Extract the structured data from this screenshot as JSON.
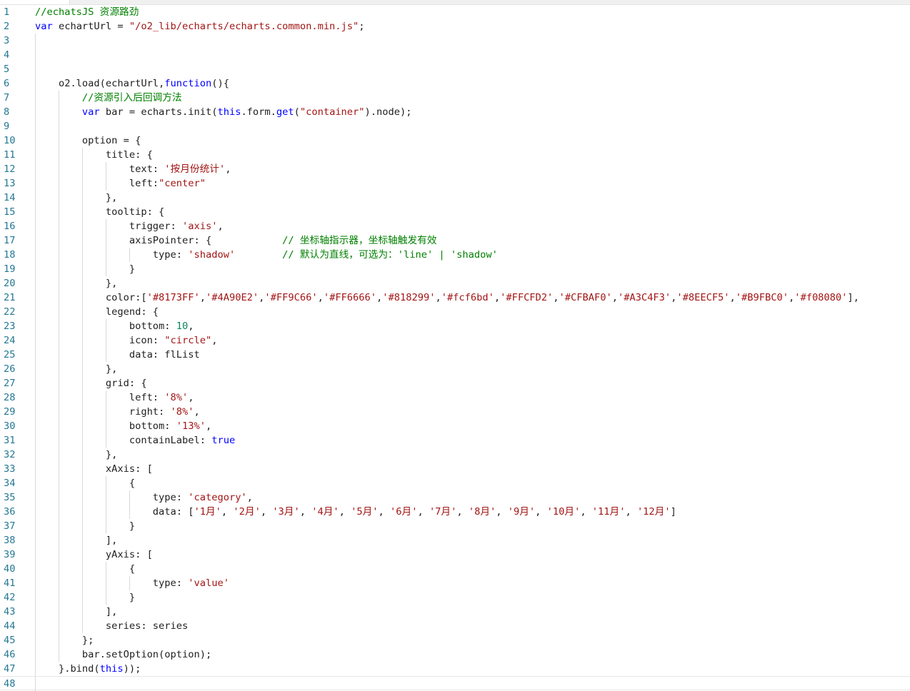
{
  "lines": [
    [
      [
        "c",
        "//echatsJS 资源路劲"
      ]
    ],
    [
      [
        "k",
        "var"
      ],
      [
        "p",
        " echartUrl = "
      ],
      [
        "s",
        "\"/o2_lib/echarts/echarts.common.min.js\""
      ],
      [
        "p",
        ";"
      ]
    ],
    [],
    [],
    [],
    [
      [
        "p",
        "    o2.load(echartUrl,"
      ],
      [
        "k",
        "function"
      ],
      [
        "p",
        "(){"
      ]
    ],
    [
      [
        "c",
        "        //资源引入后回调方法"
      ]
    ],
    [
      [
        "k",
        "        var"
      ],
      [
        "p",
        " bar = echarts.init("
      ],
      [
        "k",
        "this"
      ],
      [
        "p",
        ".form."
      ],
      [
        "k",
        "get"
      ],
      [
        "p",
        "("
      ],
      [
        "s",
        "\"container\""
      ],
      [
        "p",
        ").node);"
      ]
    ],
    [],
    [
      [
        "p",
        "        option = {"
      ]
    ],
    [
      [
        "p",
        "            title: {"
      ]
    ],
    [
      [
        "p",
        "                text: "
      ],
      [
        "s",
        "'按月份统计'"
      ],
      [
        "p",
        ","
      ]
    ],
    [
      [
        "p",
        "                left:"
      ],
      [
        "s",
        "\"center\""
      ]
    ],
    [
      [
        "p",
        "            },"
      ]
    ],
    [
      [
        "p",
        "            tooltip: {"
      ]
    ],
    [
      [
        "p",
        "                trigger: "
      ],
      [
        "s",
        "'axis'"
      ],
      [
        "p",
        ","
      ]
    ],
    [
      [
        "p",
        "                axisPointer: {            "
      ],
      [
        "c",
        "// 坐标轴指示器，坐标轴触发有效"
      ]
    ],
    [
      [
        "p",
        "                    type: "
      ],
      [
        "s",
        "'shadow'"
      ],
      [
        "p",
        "        "
      ],
      [
        "c",
        "// 默认为直线，可选为：'line' | 'shadow'"
      ]
    ],
    [
      [
        "p",
        "                }"
      ]
    ],
    [
      [
        "p",
        "            },"
      ]
    ],
    [
      [
        "p",
        "            color:["
      ],
      [
        "s",
        "'#8173FF'"
      ],
      [
        "p",
        ","
      ],
      [
        "s",
        "'#4A90E2'"
      ],
      [
        "p",
        ","
      ],
      [
        "s",
        "'#FF9C66'"
      ],
      [
        "p",
        ","
      ],
      [
        "s",
        "'#FF6666'"
      ],
      [
        "p",
        ","
      ],
      [
        "s",
        "'#818299'"
      ],
      [
        "p",
        ","
      ],
      [
        "s",
        "'#fcf6bd'"
      ],
      [
        "p",
        ","
      ],
      [
        "s",
        "'#FFCFD2'"
      ],
      [
        "p",
        ","
      ],
      [
        "s",
        "'#CFBAF0'"
      ],
      [
        "p",
        ","
      ],
      [
        "s",
        "'#A3C4F3'"
      ],
      [
        "p",
        ","
      ],
      [
        "s",
        "'#8EECF5'"
      ],
      [
        "p",
        ","
      ],
      [
        "s",
        "'#B9FBC0'"
      ],
      [
        "p",
        ","
      ],
      [
        "s",
        "'#f08080'"
      ],
      [
        "p",
        "],"
      ]
    ],
    [
      [
        "p",
        "            legend: {"
      ]
    ],
    [
      [
        "p",
        "                bottom: "
      ],
      [
        "n",
        "10"
      ],
      [
        "p",
        ","
      ]
    ],
    [
      [
        "p",
        "                icon: "
      ],
      [
        "s",
        "\"circle\""
      ],
      [
        "p",
        ","
      ]
    ],
    [
      [
        "p",
        "                data: flList"
      ]
    ],
    [
      [
        "p",
        "            },"
      ]
    ],
    [
      [
        "p",
        "            grid: {"
      ]
    ],
    [
      [
        "p",
        "                left: "
      ],
      [
        "s",
        "'8%'"
      ],
      [
        "p",
        ","
      ]
    ],
    [
      [
        "p",
        "                right: "
      ],
      [
        "s",
        "'8%'"
      ],
      [
        "p",
        ","
      ]
    ],
    [
      [
        "p",
        "                bottom: "
      ],
      [
        "s",
        "'13%'"
      ],
      [
        "p",
        ","
      ]
    ],
    [
      [
        "p",
        "                containLabel: "
      ],
      [
        "k",
        "true"
      ]
    ],
    [
      [
        "p",
        "            },"
      ]
    ],
    [
      [
        "p",
        "            xAxis: ["
      ]
    ],
    [
      [
        "p",
        "                {"
      ]
    ],
    [
      [
        "p",
        "                    type: "
      ],
      [
        "s",
        "'category'"
      ],
      [
        "p",
        ","
      ]
    ],
    [
      [
        "p",
        "                    data: ["
      ],
      [
        "s",
        "'1月'"
      ],
      [
        "p",
        ", "
      ],
      [
        "s",
        "'2月'"
      ],
      [
        "p",
        ", "
      ],
      [
        "s",
        "'3月'"
      ],
      [
        "p",
        ", "
      ],
      [
        "s",
        "'4月'"
      ],
      [
        "p",
        ", "
      ],
      [
        "s",
        "'5月'"
      ],
      [
        "p",
        ", "
      ],
      [
        "s",
        "'6月'"
      ],
      [
        "p",
        ", "
      ],
      [
        "s",
        "'7月'"
      ],
      [
        "p",
        ", "
      ],
      [
        "s",
        "'8月'"
      ],
      [
        "p",
        ", "
      ],
      [
        "s",
        "'9月'"
      ],
      [
        "p",
        ", "
      ],
      [
        "s",
        "'10月'"
      ],
      [
        "p",
        ", "
      ],
      [
        "s",
        "'11月'"
      ],
      [
        "p",
        ", "
      ],
      [
        "s",
        "'12月'"
      ],
      [
        "p",
        "]"
      ]
    ],
    [
      [
        "p",
        "                }"
      ]
    ],
    [
      [
        "p",
        "            ],"
      ]
    ],
    [
      [
        "p",
        "            yAxis: ["
      ]
    ],
    [
      [
        "p",
        "                {"
      ]
    ],
    [
      [
        "p",
        "                    type: "
      ],
      [
        "s",
        "'value'"
      ]
    ],
    [
      [
        "p",
        "                }"
      ]
    ],
    [
      [
        "p",
        "            ],"
      ]
    ],
    [
      [
        "p",
        "            series: series"
      ]
    ],
    [
      [
        "p",
        "        };"
      ]
    ],
    [
      [
        "p",
        "        bar.setOption(option);"
      ]
    ],
    [
      [
        "p",
        "    }.bind("
      ],
      [
        "k",
        "this"
      ],
      [
        "p",
        "));"
      ]
    ],
    []
  ]
}
